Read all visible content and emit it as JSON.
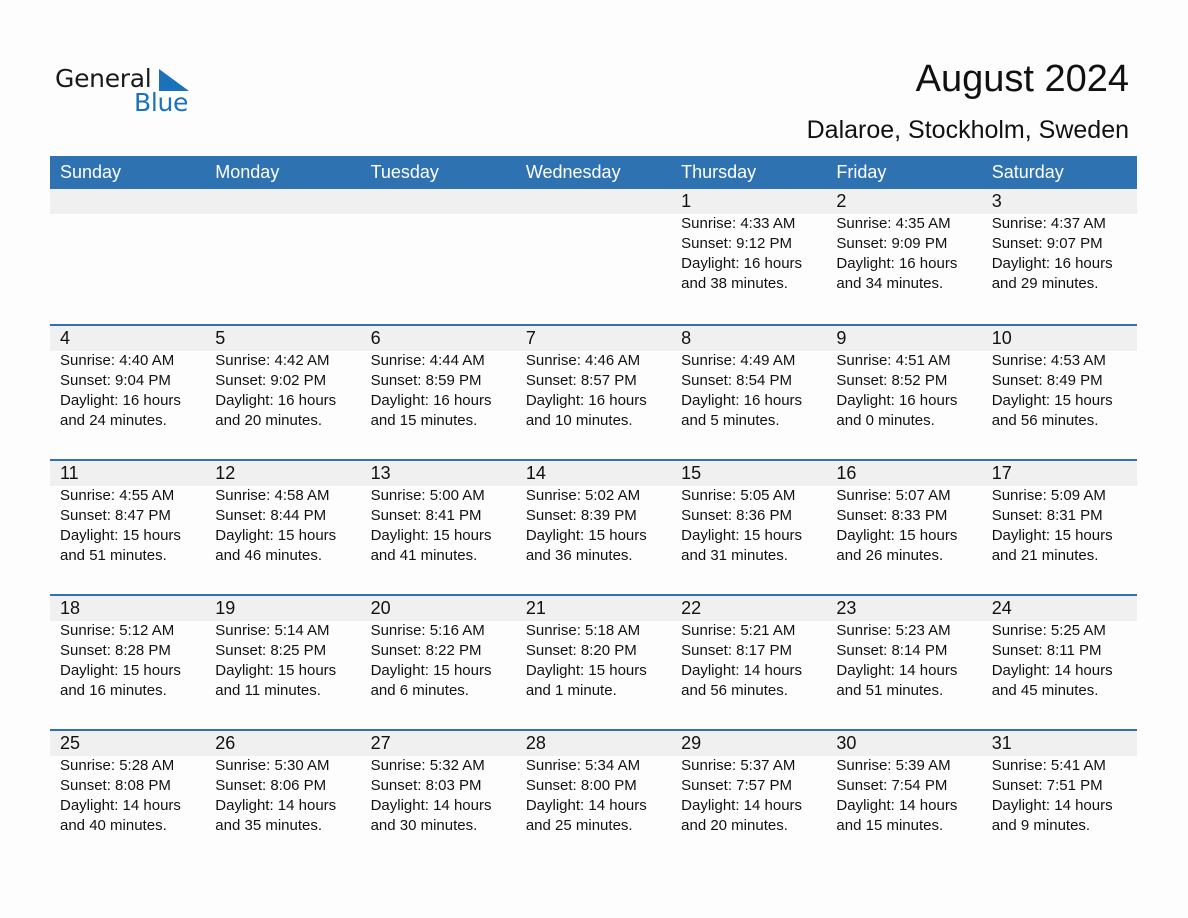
{
  "logo": {
    "word1": "General",
    "word2": "Blue"
  },
  "header": {
    "title": "August 2024",
    "location": "Dalaroe, Stockholm, Sweden"
  },
  "colors": {
    "accent": "#2e72b2",
    "logo_blue": "#1a72bb",
    "date_strip": "#f0f0f0"
  },
  "weekdays": [
    "Sunday",
    "Monday",
    "Tuesday",
    "Wednesday",
    "Thursday",
    "Friday",
    "Saturday"
  ],
  "weeks": [
    [
      null,
      null,
      null,
      null,
      {
        "day": "1",
        "sunrise": "Sunrise: 4:33 AM",
        "sunset": "Sunset: 9:12 PM",
        "daylight1": "Daylight: 16 hours",
        "daylight2": "and 38 minutes."
      },
      {
        "day": "2",
        "sunrise": "Sunrise: 4:35 AM",
        "sunset": "Sunset: 9:09 PM",
        "daylight1": "Daylight: 16 hours",
        "daylight2": "and 34 minutes."
      },
      {
        "day": "3",
        "sunrise": "Sunrise: 4:37 AM",
        "sunset": "Sunset: 9:07 PM",
        "daylight1": "Daylight: 16 hours",
        "daylight2": "and 29 minutes."
      }
    ],
    [
      {
        "day": "4",
        "sunrise": "Sunrise: 4:40 AM",
        "sunset": "Sunset: 9:04 PM",
        "daylight1": "Daylight: 16 hours",
        "daylight2": "and 24 minutes."
      },
      {
        "day": "5",
        "sunrise": "Sunrise: 4:42 AM",
        "sunset": "Sunset: 9:02 PM",
        "daylight1": "Daylight: 16 hours",
        "daylight2": "and 20 minutes."
      },
      {
        "day": "6",
        "sunrise": "Sunrise: 4:44 AM",
        "sunset": "Sunset: 8:59 PM",
        "daylight1": "Daylight: 16 hours",
        "daylight2": "and 15 minutes."
      },
      {
        "day": "7",
        "sunrise": "Sunrise: 4:46 AM",
        "sunset": "Sunset: 8:57 PM",
        "daylight1": "Daylight: 16 hours",
        "daylight2": "and 10 minutes."
      },
      {
        "day": "8",
        "sunrise": "Sunrise: 4:49 AM",
        "sunset": "Sunset: 8:54 PM",
        "daylight1": "Daylight: 16 hours",
        "daylight2": "and 5 minutes."
      },
      {
        "day": "9",
        "sunrise": "Sunrise: 4:51 AM",
        "sunset": "Sunset: 8:52 PM",
        "daylight1": "Daylight: 16 hours",
        "daylight2": "and 0 minutes."
      },
      {
        "day": "10",
        "sunrise": "Sunrise: 4:53 AM",
        "sunset": "Sunset: 8:49 PM",
        "daylight1": "Daylight: 15 hours",
        "daylight2": "and 56 minutes."
      }
    ],
    [
      {
        "day": "11",
        "sunrise": "Sunrise: 4:55 AM",
        "sunset": "Sunset: 8:47 PM",
        "daylight1": "Daylight: 15 hours",
        "daylight2": "and 51 minutes."
      },
      {
        "day": "12",
        "sunrise": "Sunrise: 4:58 AM",
        "sunset": "Sunset: 8:44 PM",
        "daylight1": "Daylight: 15 hours",
        "daylight2": "and 46 minutes."
      },
      {
        "day": "13",
        "sunrise": "Sunrise: 5:00 AM",
        "sunset": "Sunset: 8:41 PM",
        "daylight1": "Daylight: 15 hours",
        "daylight2": "and 41 minutes."
      },
      {
        "day": "14",
        "sunrise": "Sunrise: 5:02 AM",
        "sunset": "Sunset: 8:39 PM",
        "daylight1": "Daylight: 15 hours",
        "daylight2": "and 36 minutes."
      },
      {
        "day": "15",
        "sunrise": "Sunrise: 5:05 AM",
        "sunset": "Sunset: 8:36 PM",
        "daylight1": "Daylight: 15 hours",
        "daylight2": "and 31 minutes."
      },
      {
        "day": "16",
        "sunrise": "Sunrise: 5:07 AM",
        "sunset": "Sunset: 8:33 PM",
        "daylight1": "Daylight: 15 hours",
        "daylight2": "and 26 minutes."
      },
      {
        "day": "17",
        "sunrise": "Sunrise: 5:09 AM",
        "sunset": "Sunset: 8:31 PM",
        "daylight1": "Daylight: 15 hours",
        "daylight2": "and 21 minutes."
      }
    ],
    [
      {
        "day": "18",
        "sunrise": "Sunrise: 5:12 AM",
        "sunset": "Sunset: 8:28 PM",
        "daylight1": "Daylight: 15 hours",
        "daylight2": "and 16 minutes."
      },
      {
        "day": "19",
        "sunrise": "Sunrise: 5:14 AM",
        "sunset": "Sunset: 8:25 PM",
        "daylight1": "Daylight: 15 hours",
        "daylight2": "and 11 minutes."
      },
      {
        "day": "20",
        "sunrise": "Sunrise: 5:16 AM",
        "sunset": "Sunset: 8:22 PM",
        "daylight1": "Daylight: 15 hours",
        "daylight2": "and 6 minutes."
      },
      {
        "day": "21",
        "sunrise": "Sunrise: 5:18 AM",
        "sunset": "Sunset: 8:20 PM",
        "daylight1": "Daylight: 15 hours",
        "daylight2": "and 1 minute."
      },
      {
        "day": "22",
        "sunrise": "Sunrise: 5:21 AM",
        "sunset": "Sunset: 8:17 PM",
        "daylight1": "Daylight: 14 hours",
        "daylight2": "and 56 minutes."
      },
      {
        "day": "23",
        "sunrise": "Sunrise: 5:23 AM",
        "sunset": "Sunset: 8:14 PM",
        "daylight1": "Daylight: 14 hours",
        "daylight2": "and 51 minutes."
      },
      {
        "day": "24",
        "sunrise": "Sunrise: 5:25 AM",
        "sunset": "Sunset: 8:11 PM",
        "daylight1": "Daylight: 14 hours",
        "daylight2": "and 45 minutes."
      }
    ],
    [
      {
        "day": "25",
        "sunrise": "Sunrise: 5:28 AM",
        "sunset": "Sunset: 8:08 PM",
        "daylight1": "Daylight: 14 hours",
        "daylight2": "and 40 minutes."
      },
      {
        "day": "26",
        "sunrise": "Sunrise: 5:30 AM",
        "sunset": "Sunset: 8:06 PM",
        "daylight1": "Daylight: 14 hours",
        "daylight2": "and 35 minutes."
      },
      {
        "day": "27",
        "sunrise": "Sunrise: 5:32 AM",
        "sunset": "Sunset: 8:03 PM",
        "daylight1": "Daylight: 14 hours",
        "daylight2": "and 30 minutes."
      },
      {
        "day": "28",
        "sunrise": "Sunrise: 5:34 AM",
        "sunset": "Sunset: 8:00 PM",
        "daylight1": "Daylight: 14 hours",
        "daylight2": "and 25 minutes."
      },
      {
        "day": "29",
        "sunrise": "Sunrise: 5:37 AM",
        "sunset": "Sunset: 7:57 PM",
        "daylight1": "Daylight: 14 hours",
        "daylight2": "and 20 minutes."
      },
      {
        "day": "30",
        "sunrise": "Sunrise: 5:39 AM",
        "sunset": "Sunset: 7:54 PM",
        "daylight1": "Daylight: 14 hours",
        "daylight2": "and 15 minutes."
      },
      {
        "day": "31",
        "sunrise": "Sunrise: 5:41 AM",
        "sunset": "Sunset: 7:51 PM",
        "daylight1": "Daylight: 14 hours",
        "daylight2": "and 9 minutes."
      }
    ]
  ]
}
